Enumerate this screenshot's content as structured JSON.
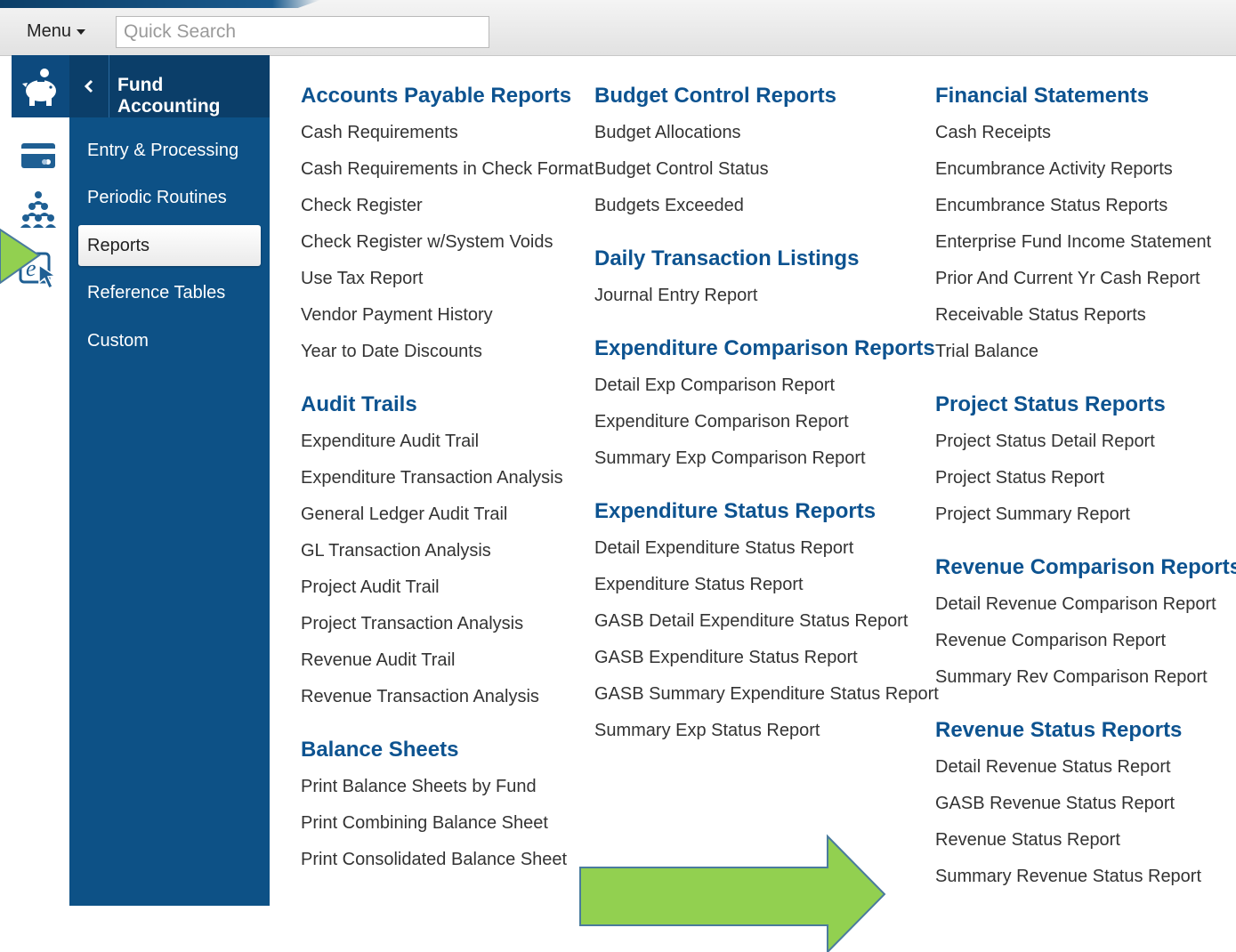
{
  "header": {
    "menu_label": "Menu",
    "search_placeholder": "Quick Search"
  },
  "icons": [
    "piggy-bank-icon",
    "payment-card-icon",
    "people-group-icon",
    "e-click-icon"
  ],
  "colors": {
    "brand": "#0d5186",
    "heading": "#0d5390",
    "arrow": "#92d050"
  },
  "sidebar": {
    "title": "Fund Accounting",
    "items": [
      {
        "label": "Entry & Processing"
      },
      {
        "label": "Periodic Routines"
      },
      {
        "label": "Reports",
        "active": true
      },
      {
        "label": "Reference Tables"
      },
      {
        "label": "Custom"
      }
    ]
  },
  "columns": [
    {
      "groups": [
        {
          "title": "Accounts Payable Reports",
          "items": [
            "Cash Requirements",
            "Cash Requirements in Check Format",
            "Check Register",
            "Check Register w/System Voids",
            "Use Tax Report",
            "Vendor Payment History",
            "Year to Date Discounts"
          ]
        },
        {
          "title": "Audit Trails",
          "items": [
            "Expenditure Audit Trail",
            "Expenditure Transaction Analysis",
            "General Ledger Audit Trail",
            "GL Transaction Analysis",
            "Project Audit Trail",
            "Project Transaction Analysis",
            "Revenue Audit Trail",
            "Revenue Transaction Analysis"
          ]
        },
        {
          "title": "Balance Sheets",
          "items": [
            "Print Balance Sheets by Fund",
            "Print Combining Balance Sheet",
            "Print Consolidated Balance Sheet"
          ]
        }
      ]
    },
    {
      "groups": [
        {
          "title": "Budget Control Reports",
          "items": [
            "Budget Allocations",
            "Budget Control Status",
            "Budgets Exceeded"
          ]
        },
        {
          "title": "Daily Transaction Listings",
          "items": [
            "Journal Entry Report"
          ]
        },
        {
          "title": "Expenditure Comparison Reports",
          "items": [
            "Detail Exp Comparison Report",
            "Expenditure Comparison Report",
            "Summary Exp Comparison Report"
          ]
        },
        {
          "title": "Expenditure Status Reports",
          "items": [
            "Detail Expenditure Status Report",
            "Expenditure Status Report",
            "GASB Detail Expenditure Status Report",
            "GASB Expenditure Status Report",
            "GASB Summary Expenditure Status Report",
            "Summary Exp Status Report"
          ]
        }
      ]
    },
    {
      "groups": [
        {
          "title": "Financial Statements",
          "items": [
            "Cash Receipts",
            "Encumbrance Activity Reports",
            "Encumbrance Status Reports",
            "Enterprise Fund Income Statement",
            "Prior And Current Yr Cash Report",
            "Receivable Status Reports",
            "Trial Balance"
          ]
        },
        {
          "title": "Project Status Reports",
          "items": [
            "Project Status Detail Report",
            "Project Status Report",
            "Project Summary Report"
          ]
        },
        {
          "title": "Revenue Comparison Reports",
          "items": [
            "Detail Revenue Comparison Report",
            "Revenue Comparison Report",
            "Summary Rev Comparison Report"
          ]
        },
        {
          "title": "Revenue Status Reports",
          "items": [
            "Detail Revenue Status Report",
            "GASB Revenue Status Report",
            "Revenue Status Report",
            "Summary Revenue Status Report"
          ]
        }
      ]
    }
  ]
}
